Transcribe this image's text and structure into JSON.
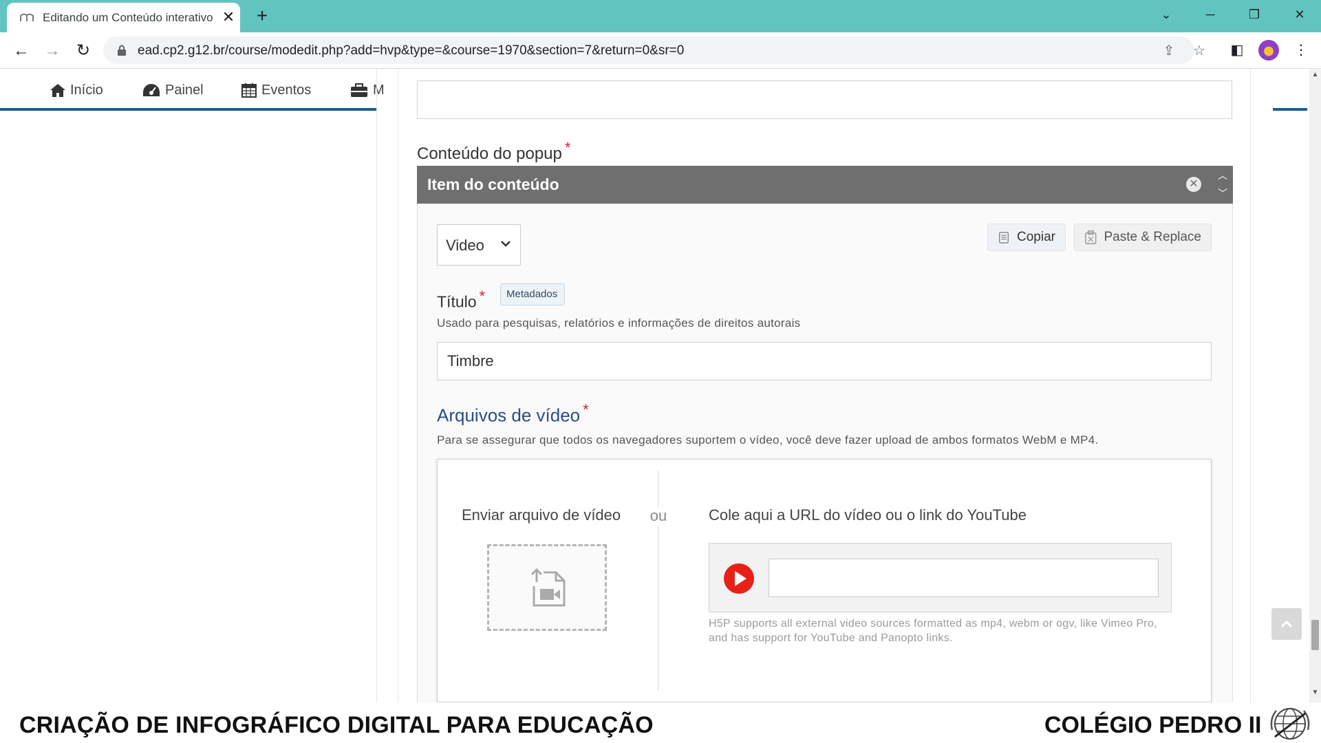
{
  "browser": {
    "tab_title": "Editando um Conteúdo interativo",
    "tab_close": "✕",
    "new_tab": "+",
    "url": "ead.cp2.g12.br/course/modedit.php?add=hvp&type=&course=1970&section=7&return=0&sr=0"
  },
  "site_nav": {
    "items": [
      {
        "label": "Início",
        "icon": "home-icon"
      },
      {
        "label": "Painel",
        "icon": "dashboard-icon"
      },
      {
        "label": "Eventos",
        "icon": "calendar-icon"
      },
      {
        "label": "M",
        "icon": "briefcase-icon"
      }
    ]
  },
  "form": {
    "popup_label": "Conteúdo do popup",
    "required_mark": "*",
    "item_header": "Item do conteúdo",
    "content_type": "Video",
    "copy_label": "Copiar",
    "paste_label": "Paste & Replace",
    "titulo_label": "Título",
    "metadata_badge": "Metadados",
    "titulo_description": "Usado para pesquisas, relatórios e informações de direitos autorais",
    "titulo_value": "Timbre",
    "video_label": "Arquivos de vídeo",
    "video_description": "Para se assegurar que todos os navegadores suportem o vídeo, você deve fazer upload de ambos formatos WebM e MP4.",
    "upload_label": "Enviar arquivo de vídeo",
    "or_text": "ou",
    "url_label": "Cole aqui a URL do vídeo ou o link do YouTube",
    "url_hint": "H5P supports all external video sources formatted as mp4, webm or ogv, like Vimeo Pro, and has support for YouTube and Panopto links."
  },
  "footer": {
    "left_text": "CRIAÇÃO DE INFOGRÁFICO DIGITAL PARA EDUCAÇÃO",
    "right_text": "COLÉGIO PEDRO II"
  },
  "colors": {
    "tabbar": "#62c4bf",
    "nav_accent": "#1b5e94",
    "item_header": "#6f6f6f",
    "required": "#d2222d",
    "section_label": "#2a4d85",
    "youtube_red": "#e62117"
  }
}
